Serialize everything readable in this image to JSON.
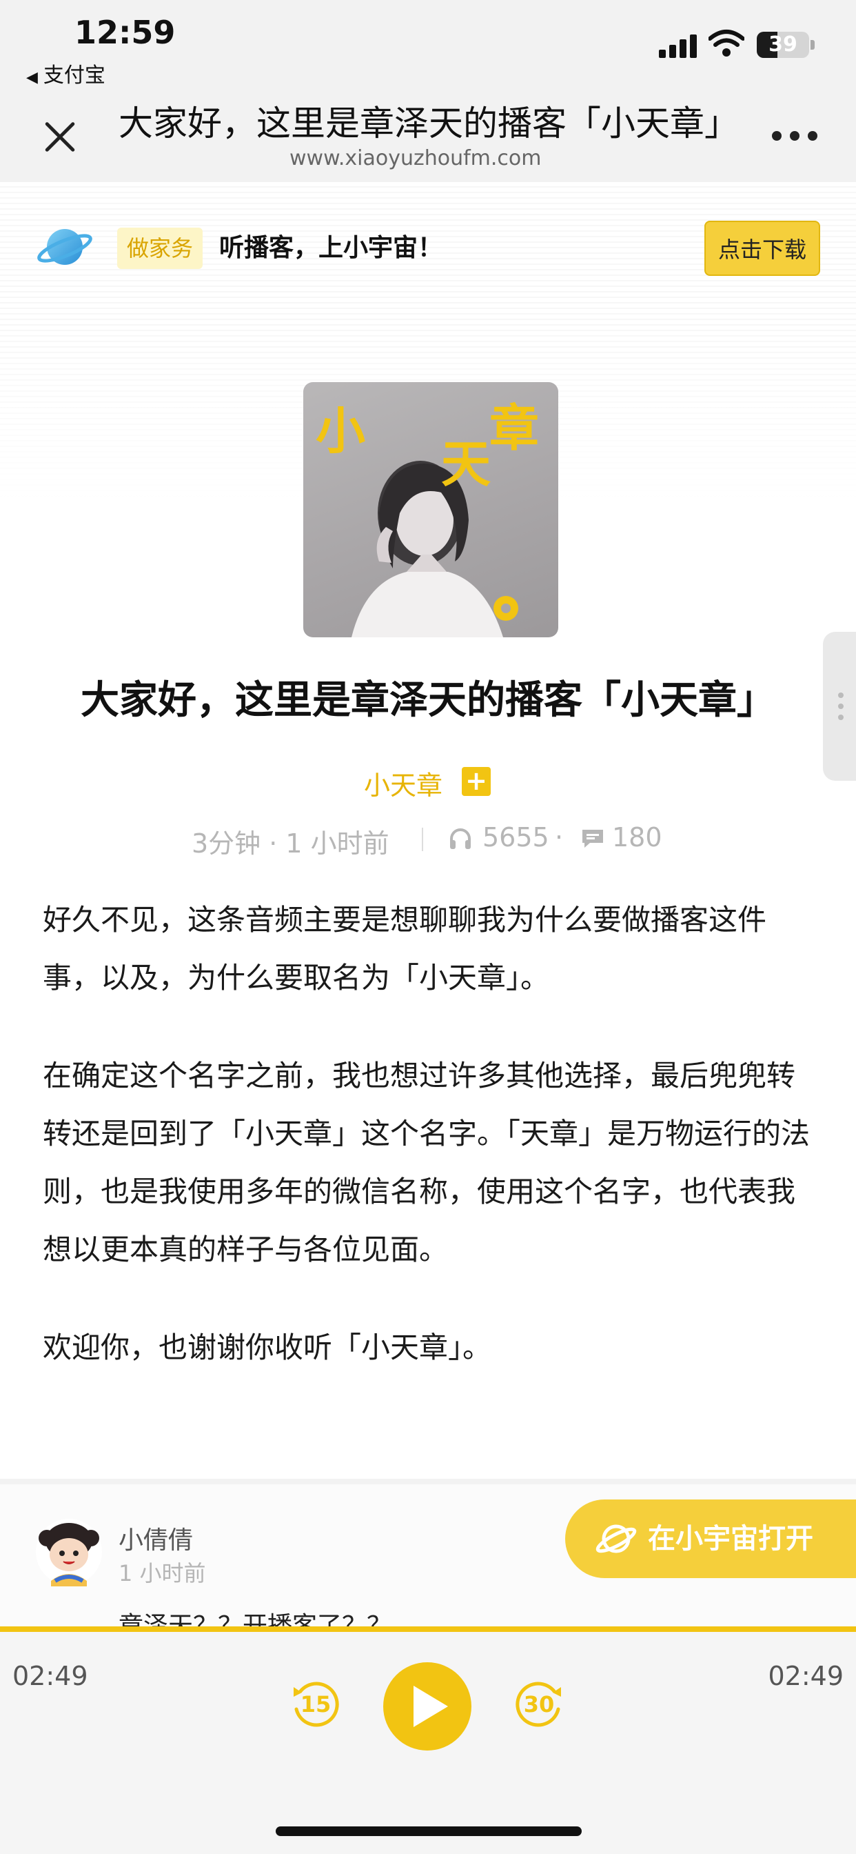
{
  "status_bar": {
    "time": "12:59",
    "back_app": "支付宝",
    "battery_percent": "39",
    "battery_level": 0.39
  },
  "nav": {
    "title": "大家好，这里是章泽天的播客「小天章」",
    "url": "www.xiaoyuzhoufm.com"
  },
  "promo": {
    "tag": "做家务",
    "text": "听播客，上小宇宙！",
    "download_label": "点击下载"
  },
  "cover": {
    "characters": [
      "小",
      "天",
      "章"
    ]
  },
  "episode": {
    "title": "大家好，这里是章泽天的播客「小天章」",
    "podcast_name": "小天章",
    "follow_symbol": "+",
    "duration_and_time": "3分钟 · 1 小时前",
    "listens": "5655",
    "dot": "·",
    "comments": "180",
    "description": [
      "好久不见，这条音频主要是想聊聊我为什么要做播客这件事，以及，为什么要取名为「小天章」。",
      "在确定这个名字之前，我也想过许多其他选择，最后兜兜转转还是回到了「小天章」这个名字。「天章」是万物运行的法则，也是我使用多年的微信名称，使用这个名字，也代表我想以更本真的样子与各位见面。",
      "欢迎你，也谢谢你收听「小天章」。"
    ]
  },
  "comment": {
    "user": "小倩倩",
    "time": "1 小时前",
    "text": "章泽天？？开播客了？？"
  },
  "open_app": {
    "label": "在小宇宙打开"
  },
  "player": {
    "elapsed": "02:49",
    "total": "02:49",
    "progress": 1.0,
    "rewind_seconds": "15",
    "forward_seconds": "30"
  },
  "colors": {
    "accent": "#f2c412",
    "background": "#ffffff",
    "chrome": "#f2f2f2"
  }
}
